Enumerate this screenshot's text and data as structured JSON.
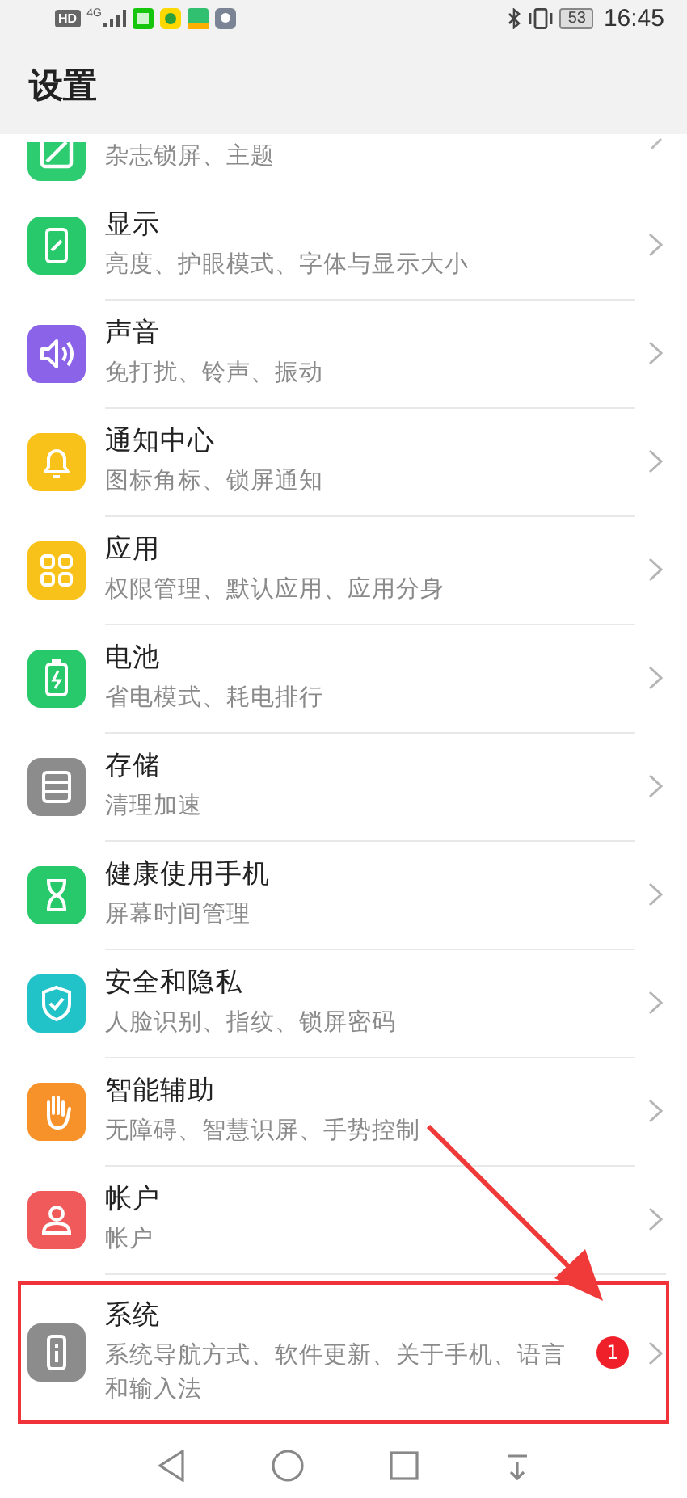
{
  "status_bar": {
    "left": [
      "HD",
      "4G"
    ],
    "battery": "53",
    "time": "16:45"
  },
  "title": "设置",
  "items": [
    {
      "kind": "partial",
      "subtitle": "杂志锁屏、主题",
      "color": "#2ecc71",
      "highlighted": false
    },
    {
      "kind": "row",
      "title": "显示",
      "subtitle": "亮度、护眼模式、字体与显示大小",
      "color": "#27c96a",
      "highlighted": false
    },
    {
      "kind": "row",
      "title": "声音",
      "subtitle": "免打扰、铃声、振动",
      "color": "#8a63e8",
      "highlighted": false
    },
    {
      "kind": "row",
      "title": "通知中心",
      "subtitle": "图标角标、锁屏通知",
      "color": "#f9c21b",
      "highlighted": false
    },
    {
      "kind": "row",
      "title": "应用",
      "subtitle": "权限管理、默认应用、应用分身",
      "color": "#f9c21b",
      "highlighted": false
    },
    {
      "kind": "row",
      "title": "电池",
      "subtitle": "省电模式、耗电排行",
      "color": "#27c96a",
      "highlighted": false
    },
    {
      "kind": "row",
      "title": "存储",
      "subtitle": "清理加速",
      "color": "#8c8c8c",
      "highlighted": false
    },
    {
      "kind": "row",
      "title": "健康使用手机",
      "subtitle": "屏幕时间管理",
      "color": "#27c96a",
      "highlighted": false
    },
    {
      "kind": "row",
      "title": "安全和隐私",
      "subtitle": "人脸识别、指纹、锁屏密码",
      "color": "#22c3c8",
      "highlighted": false
    },
    {
      "kind": "row",
      "title": "智能辅助",
      "subtitle": "无障碍、智慧识屏、手势控制",
      "color": "#f7922a",
      "highlighted": false
    },
    {
      "kind": "row",
      "title": "帐户",
      "subtitle": "帐户",
      "color": "#f05a5a",
      "highlighted": false
    },
    {
      "kind": "row",
      "title": "系统",
      "subtitle": "系统导航方式、软件更新、关于手机、语言和输入法",
      "color": "#8c8c8c",
      "badge": "1",
      "highlighted": true
    }
  ]
}
